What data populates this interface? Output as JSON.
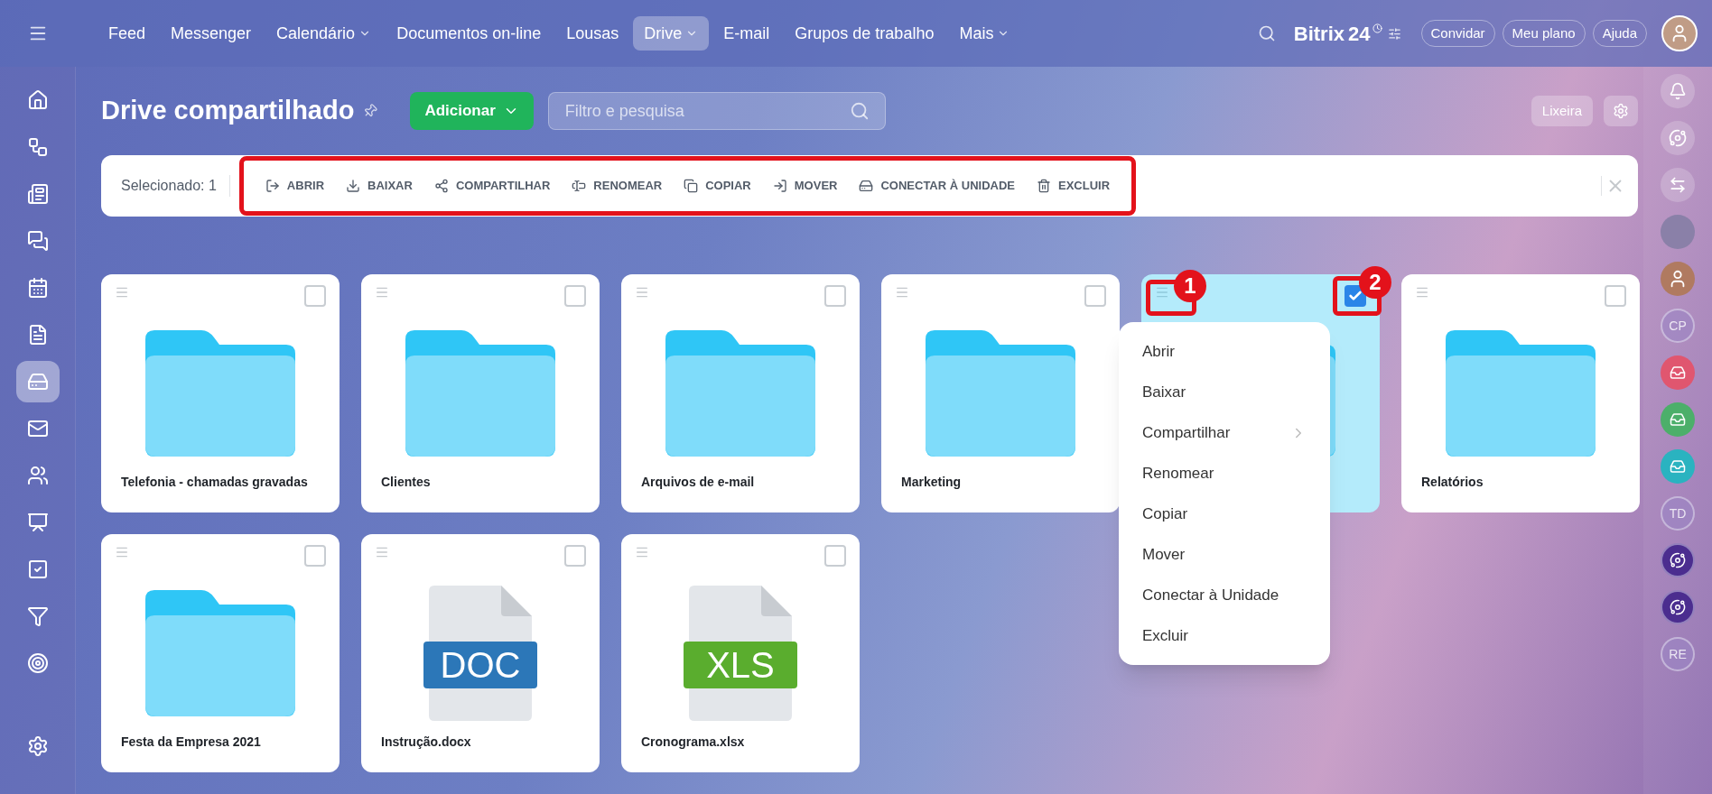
{
  "top_nav": [
    {
      "label": "Feed",
      "selected": false,
      "dropdown": false
    },
    {
      "label": "Messenger",
      "selected": false,
      "dropdown": false
    },
    {
      "label": "Calendário",
      "selected": false,
      "dropdown": true
    },
    {
      "label": "Documentos on-line",
      "selected": false,
      "dropdown": false
    },
    {
      "label": "Lousas",
      "selected": false,
      "dropdown": false
    },
    {
      "label": "Drive",
      "selected": true,
      "dropdown": true
    },
    {
      "label": "E-mail",
      "selected": false,
      "dropdown": false
    },
    {
      "label": "Grupos de trabalho",
      "selected": false,
      "dropdown": false
    },
    {
      "label": "Mais",
      "selected": false,
      "dropdown": true
    }
  ],
  "logo": {
    "name": "Bitrix",
    "suffix": "24"
  },
  "header_buttons": [
    "Convidar",
    "Meu plano",
    "Ajuda"
  ],
  "left_sidebar": [
    {
      "kind": "home",
      "selected": false
    },
    {
      "kind": "flow",
      "selected": false
    },
    {
      "kind": "news",
      "selected": false
    },
    {
      "kind": "chat",
      "selected": false
    },
    {
      "kind": "calendar",
      "selected": false
    },
    {
      "kind": "document",
      "selected": false
    },
    {
      "kind": "drive",
      "selected": true
    },
    {
      "kind": "mail",
      "selected": false
    },
    {
      "kind": "users",
      "selected": false
    },
    {
      "kind": "board",
      "selected": false
    },
    {
      "kind": "tasks",
      "selected": false
    },
    {
      "kind": "funnel",
      "selected": false
    },
    {
      "kind": "target",
      "selected": false
    },
    {
      "kind": "settings",
      "selected": false
    }
  ],
  "page": {
    "title": "Drive compartilhado",
    "add_button": "Adicionar",
    "search": {
      "placeholder": "Filtro e pesquisa"
    },
    "trash_button": "Lixeira"
  },
  "selection_bar": {
    "label": "Selecionado: 1",
    "highlighted": true,
    "actions": [
      {
        "kind": "open",
        "label": "ABRIR"
      },
      {
        "kind": "download",
        "label": "BAIXAR"
      },
      {
        "kind": "share",
        "label": "COMPARTILHAR"
      },
      {
        "kind": "rename",
        "label": "RENOMEAR"
      },
      {
        "kind": "copy",
        "label": "COPIAR"
      },
      {
        "kind": "move",
        "label": "MOVER"
      },
      {
        "kind": "drive",
        "label": "CONECTAR À UNIDADE"
      },
      {
        "kind": "delete",
        "label": "EXCLUIR"
      }
    ]
  },
  "items": [
    {
      "kind": "folder",
      "name": "Telefonia - chamadas gravadas",
      "checked": false
    },
    {
      "kind": "folder",
      "name": "Clientes",
      "checked": false
    },
    {
      "kind": "folder",
      "name": "Arquivos de e-mail",
      "checked": false
    },
    {
      "kind": "folder",
      "name": "Marketing",
      "checked": false
    },
    {
      "kind": "folder",
      "checked": true,
      "menu_open": true,
      "handle_badge": "1",
      "check_badge": "2"
    },
    {
      "kind": "folder",
      "name": "Relatórios",
      "checked": false
    },
    {
      "kind": "folder",
      "name": "Festa da Empresa 2021",
      "checked": false
    },
    {
      "kind": "doc",
      "name": "Instrução.docx",
      "badge": "DOC",
      "checked": false
    },
    {
      "kind": "xls",
      "name": "Cronograma.xlsx",
      "badge": "XLS",
      "checked": false
    }
  ],
  "context_menu": [
    {
      "label": "Abrir",
      "submenu": false
    },
    {
      "label": "Baixar",
      "submenu": false
    },
    {
      "label": "Compartilhar",
      "submenu": true
    },
    {
      "label": "Renomear",
      "submenu": false
    },
    {
      "label": "Copiar",
      "submenu": false
    },
    {
      "label": "Mover",
      "submenu": false
    },
    {
      "label": "Conectar à Unidade",
      "submenu": false
    },
    {
      "label": "Excluir",
      "submenu": false
    }
  ],
  "right_sidebar": [
    {
      "kind": "bell"
    },
    {
      "kind": "copilot"
    },
    {
      "kind": "exchange"
    },
    {
      "kind": "photo"
    },
    {
      "kind": "person"
    },
    {
      "kind": "initials",
      "text": "CP"
    },
    {
      "kind": "app",
      "color": "#e0566f"
    },
    {
      "kind": "app",
      "color": "#4caf6a"
    },
    {
      "kind": "app",
      "color": "#2ab3c0"
    },
    {
      "kind": "initials",
      "text": "TD"
    },
    {
      "kind": "copilot-dark"
    },
    {
      "kind": "copilot-dark"
    },
    {
      "kind": "initials",
      "text": "RE"
    }
  ]
}
